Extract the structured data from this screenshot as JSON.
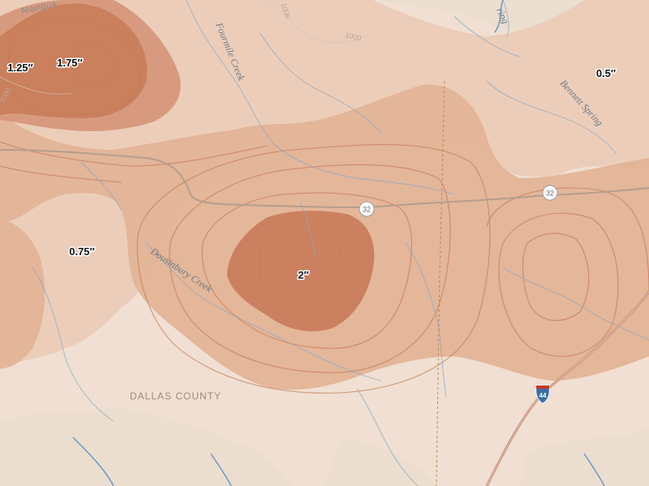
{
  "map": {
    "legend_colors": {
      "base": "#ece6dc",
      "band_0_5": "#f1d9cb",
      "band_0_75": "#e7c0a8",
      "band_1_25": "#d89878",
      "band_1_75": "#c97b57",
      "band_2": "#c47a55",
      "contour_line": "#c67c57",
      "water": "#8aa7c4",
      "forest": "#cfe3c4"
    },
    "amount_labels": [
      {
        "id": "label-1-25",
        "text": "1.25″"
      },
      {
        "id": "label-1-75",
        "text": "1.75″"
      },
      {
        "id": "label-0-5",
        "text": "0.5″"
      },
      {
        "id": "label-0-75",
        "text": "0.75″"
      },
      {
        "id": "label-2",
        "text": "2″"
      }
    ],
    "places": [
      {
        "id": "place-niangua",
        "text": "Niangua"
      },
      {
        "id": "place-spring",
        "text": "ring"
      }
    ],
    "waterways": [
      {
        "id": "fourmile-creek",
        "text": "Fourmile Creek"
      },
      {
        "id": "bennett-spring",
        "text": "Bennett Spring"
      },
      {
        "id": "dousinbury-creek",
        "text": "Dousinbury Creek"
      }
    ],
    "county_label": "DALLAS COUNTY",
    "elevation_labels": [
      "1000",
      "1000",
      "1000"
    ],
    "routes": [
      {
        "id": "route-32-west",
        "text": "32"
      },
      {
        "id": "route-32-east",
        "text": "32"
      },
      {
        "id": "interstate-44",
        "text": "44"
      }
    ]
  }
}
